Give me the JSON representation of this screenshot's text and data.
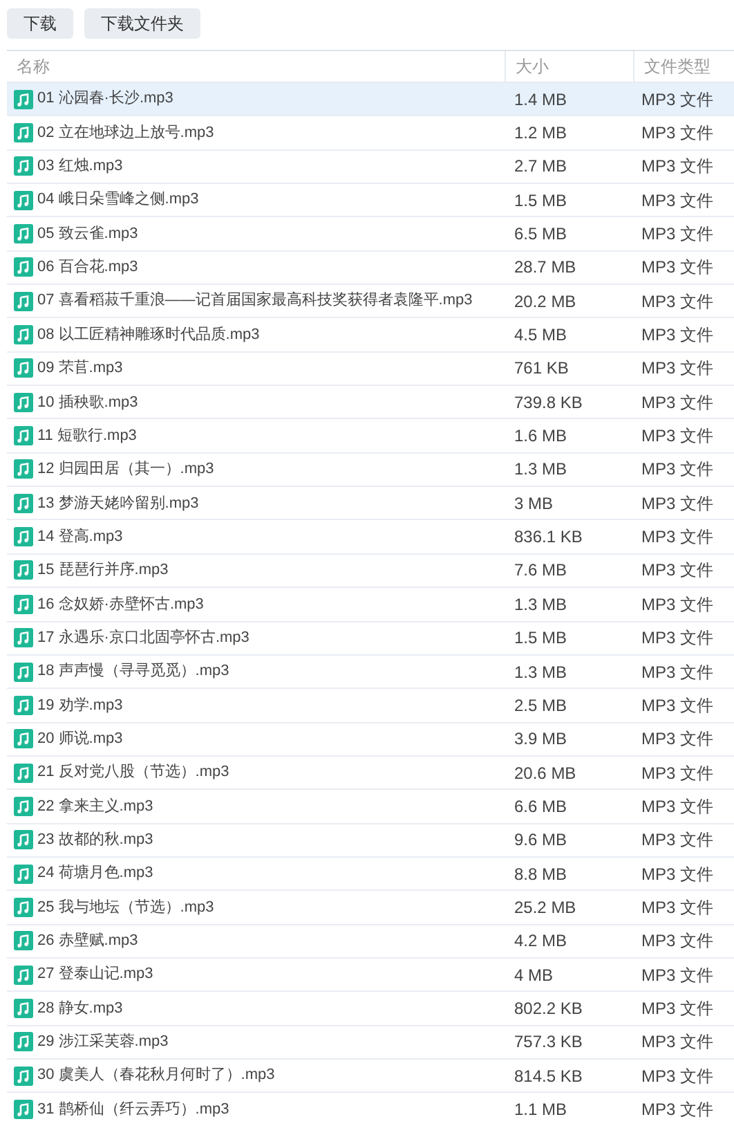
{
  "toolbar": {
    "buttons": [
      "下载",
      "下载文件夹"
    ]
  },
  "table": {
    "columns": [
      "名称",
      "大小",
      "文件类型"
    ],
    "rows": [
      {
        "name": "01 沁园春·长沙.mp3",
        "size": "1.4 MB",
        "type": "MP3 文件",
        "selected": true
      },
      {
        "name": "02 立在地球边上放号.mp3",
        "size": "1.2 MB",
        "type": "MP3 文件",
        "selected": false
      },
      {
        "name": "03 红烛.mp3",
        "size": "2.7 MB",
        "type": "MP3 文件",
        "selected": false
      },
      {
        "name": "04 峨日朵雪峰之侧.mp3",
        "size": "1.5 MB",
        "type": "MP3 文件",
        "selected": false
      },
      {
        "name": "05 致云雀.mp3",
        "size": "6.5 MB",
        "type": "MP3 文件",
        "selected": false
      },
      {
        "name": "06 百合花.mp3",
        "size": "28.7 MB",
        "type": "MP3 文件",
        "selected": false
      },
      {
        "name": "07 喜看稻菽千重浪——记首届国家最高科技奖获得者袁隆平.mp3",
        "size": "20.2 MB",
        "type": "MP3 文件",
        "selected": false
      },
      {
        "name": "08 以工匠精神雕琢时代品质.mp3",
        "size": "4.5 MB",
        "type": "MP3 文件",
        "selected": false
      },
      {
        "name": "09 芣苢.mp3",
        "size": "761 KB",
        "type": "MP3 文件",
        "selected": false
      },
      {
        "name": "10 插秧歌.mp3",
        "size": "739.8 KB",
        "type": "MP3 文件",
        "selected": false
      },
      {
        "name": "11 短歌行.mp3",
        "size": "1.6 MB",
        "type": "MP3 文件",
        "selected": false
      },
      {
        "name": "12 归园田居（其一）.mp3",
        "size": "1.3 MB",
        "type": "MP3 文件",
        "selected": false
      },
      {
        "name": "13 梦游天姥吟留别.mp3",
        "size": "3 MB",
        "type": "MP3 文件",
        "selected": false
      },
      {
        "name": "14 登高.mp3",
        "size": "836.1 KB",
        "type": "MP3 文件",
        "selected": false
      },
      {
        "name": "15 琵琶行并序.mp3",
        "size": "7.6 MB",
        "type": "MP3 文件",
        "selected": false
      },
      {
        "name": "16 念奴娇·赤壁怀古.mp3",
        "size": "1.3 MB",
        "type": "MP3 文件",
        "selected": false
      },
      {
        "name": "17 永遇乐·京口北固亭怀古.mp3",
        "size": "1.5 MB",
        "type": "MP3 文件",
        "selected": false
      },
      {
        "name": "18 声声慢（寻寻觅觅）.mp3",
        "size": "1.3 MB",
        "type": "MP3 文件",
        "selected": false
      },
      {
        "name": "19 劝学.mp3",
        "size": "2.5 MB",
        "type": "MP3 文件",
        "selected": false
      },
      {
        "name": "20 师说.mp3",
        "size": "3.9 MB",
        "type": "MP3 文件",
        "selected": false
      },
      {
        "name": "21 反对党八股（节选）.mp3",
        "size": "20.6 MB",
        "type": "MP3 文件",
        "selected": false
      },
      {
        "name": "22 拿来主义.mp3",
        "size": "6.6 MB",
        "type": "MP3 文件",
        "selected": false
      },
      {
        "name": "23 故都的秋.mp3",
        "size": "9.6 MB",
        "type": "MP3 文件",
        "selected": false
      },
      {
        "name": "24 荷塘月色.mp3",
        "size": "8.8 MB",
        "type": "MP3 文件",
        "selected": false
      },
      {
        "name": "25 我与地坛（节选）.mp3",
        "size": "25.2 MB",
        "type": "MP3 文件",
        "selected": false
      },
      {
        "name": "26 赤壁赋.mp3",
        "size": "4.2 MB",
        "type": "MP3 文件",
        "selected": false
      },
      {
        "name": "27 登泰山记.mp3",
        "size": "4 MB",
        "type": "MP3 文件",
        "selected": false
      },
      {
        "name": "28 静女.mp3",
        "size": "802.2 KB",
        "type": "MP3 文件",
        "selected": false
      },
      {
        "name": "29 涉江采芙蓉.mp3",
        "size": "757.3 KB",
        "type": "MP3 文件",
        "selected": false
      },
      {
        "name": "30 虞美人（春花秋月何时了）.mp3",
        "size": "814.5 KB",
        "type": "MP3 文件",
        "selected": false
      },
      {
        "name": "31 鹊桥仙（纤云弄巧）.mp3",
        "size": "1.1 MB",
        "type": "MP3 文件",
        "selected": false
      }
    ]
  }
}
